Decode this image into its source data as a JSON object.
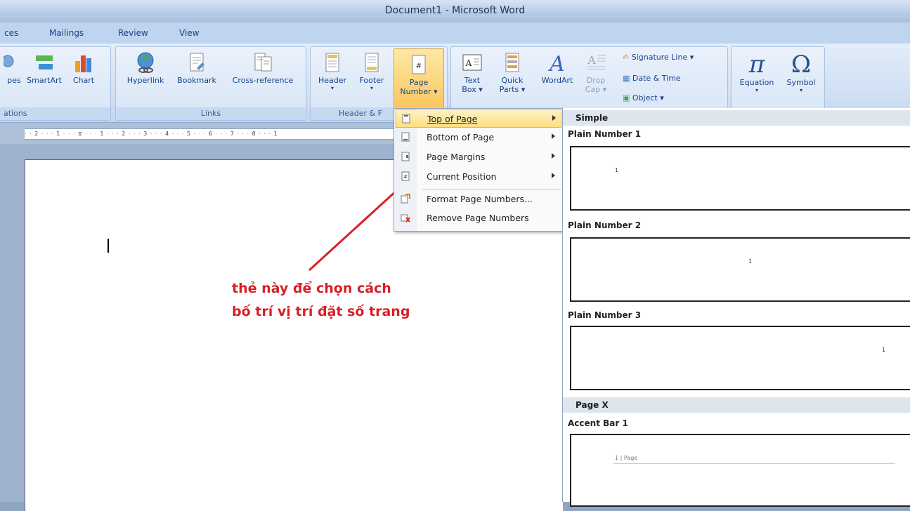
{
  "window": {
    "title": "Document1 - Microsoft Word"
  },
  "tabs": {
    "insert_partial": "ces",
    "mailings": "Mailings",
    "review": "Review",
    "view": "View"
  },
  "ribbon": {
    "illustrations": {
      "shapes_partial": "pes",
      "smartart": "SmartArt",
      "chart": "Chart",
      "label_partial": "ations"
    },
    "links": {
      "hyperlink": "Hyperlink",
      "bookmark": "Bookmark",
      "cross_reference": "Cross-reference",
      "label": "Links"
    },
    "header_footer": {
      "header": "Header",
      "footer": "Footer",
      "page_number_l1": "Page",
      "page_number_l2": "Number ▾",
      "label_partial": "Header & F"
    },
    "text": {
      "text_box_l1": "Text",
      "text_box_l2": "Box ▾",
      "quick_parts_l1": "Quick",
      "quick_parts_l2": "Parts ▾",
      "wordart": "WordArt",
      "drop_cap_l1": "Drop",
      "drop_cap_l2": "Cap ▾",
      "signature_line": "Signature Line ▾",
      "date_time": "Date & Time",
      "object": "Object ▾"
    },
    "symbols": {
      "equation": "Equation",
      "symbol": "Symbol",
      "pi_glyph": "π",
      "omega_glyph": "Ω"
    }
  },
  "ruler": {
    "ticks": "· · 2 · · · 1 · · · ⧖ · · · 1 · · · 2 · · · 3 · · · 4 · · · 5 · · · 6 · · · 7 · · · 8 · · · 1"
  },
  "menu": {
    "items": [
      {
        "label": "Top of Page",
        "has_submenu": true,
        "highlighted": true
      },
      {
        "label": "Bottom of Page",
        "has_submenu": true
      },
      {
        "label": "Page Margins",
        "has_submenu": true
      },
      {
        "label": "Current Position",
        "has_submenu": true
      },
      {
        "label": "Format Page Numbers...",
        "has_submenu": false
      },
      {
        "label": "Remove Page Numbers",
        "has_submenu": false
      }
    ]
  },
  "gallery": {
    "section_simple": "Simple",
    "plain1": "Plain Number 1",
    "plain2": "Plain Number 2",
    "plain3": "Plain Number 3",
    "section_pagex": "Page X",
    "accent1": "Accent Bar 1",
    "num_sample": "1",
    "accent_sample": "1 | Page"
  },
  "annotation": {
    "text": "thẻ này để chọn cách bố trí vị trí đặt số trang"
  },
  "colors": {
    "annotation": "#d81f26",
    "ribbon_text": "#15428b",
    "highlight": "#fddf80"
  }
}
